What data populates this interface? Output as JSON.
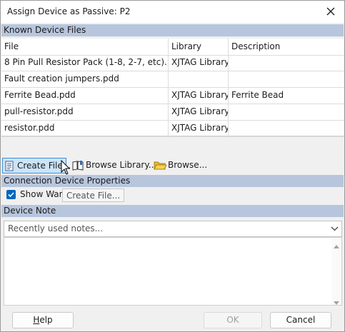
{
  "window": {
    "title": "Assign Device as Passive: P2"
  },
  "known_files": {
    "header": "Known Device Files",
    "columns": [
      "File",
      "Library",
      "Description"
    ],
    "rows": [
      {
        "file": "8 Pin Pull Resistor Pack (1-8, 2-7, etc).pdd",
        "library": "XJTAG Library",
        "description": ""
      },
      {
        "file": "Fault creation jumpers.pdd",
        "library": "",
        "description": ""
      },
      {
        "file": "Ferrite Bead.pdd",
        "library": "XJTAG Library",
        "description": "Ferrite Bead"
      },
      {
        "file": "pull-resistor.pdd",
        "library": "XJTAG Library",
        "description": ""
      },
      {
        "file": "resistor.pdd",
        "library": "XJTAG Library",
        "description": ""
      }
    ]
  },
  "toolbar": {
    "create_file": "Create File...",
    "browse_library": "Browse Library...",
    "browse": "Browse..."
  },
  "connection": {
    "header": "Connection Device Properties",
    "show_warnings_label": "Show Warn",
    "show_warnings_checked": true
  },
  "tooltip": {
    "text": "Create File..."
  },
  "device_note": {
    "header": "Device Note",
    "recent_notes_value": "Recently used notes...",
    "note_text": ""
  },
  "buttons": {
    "help_underlined": "H",
    "help_rest": "elp",
    "ok": "OK",
    "cancel": "Cancel"
  },
  "colors": {
    "section_header": "#b7c6dd",
    "selected_button": "#cce4f7",
    "checkbox": "#0067c0"
  }
}
